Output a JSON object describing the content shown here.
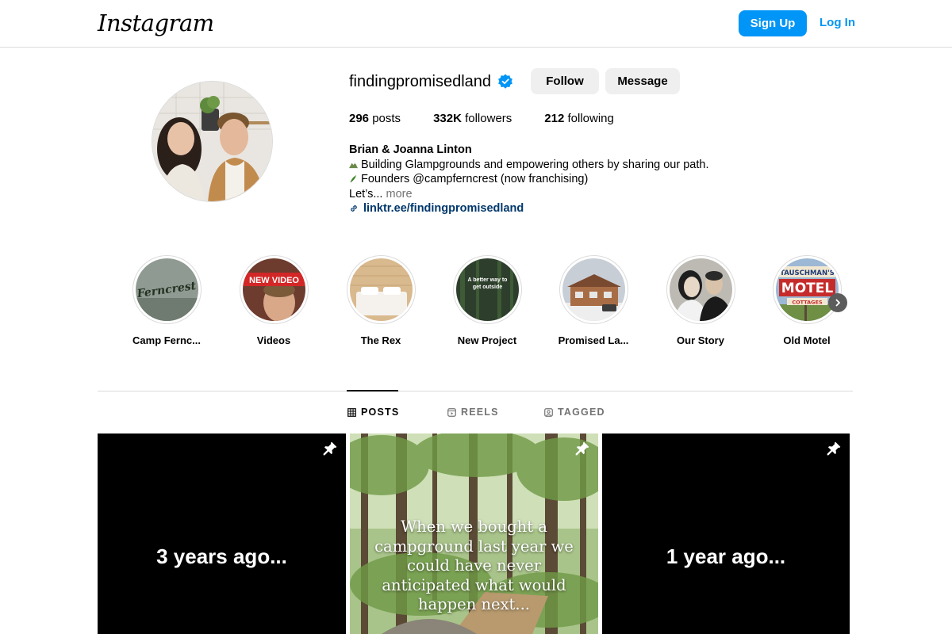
{
  "header": {
    "logo_text": "Instagram",
    "signup_label": "Sign Up",
    "login_label": "Log In"
  },
  "profile": {
    "username": "findingpromisedland",
    "verified": true,
    "follow_label": "Follow",
    "message_label": "Message",
    "stats": [
      {
        "count": "296",
        "label": "posts"
      },
      {
        "count": "332K",
        "label": "followers"
      },
      {
        "count": "212",
        "label": "following"
      }
    ],
    "bio": {
      "name": "Brian & Joanna Linton",
      "line1": "Building Glampgrounds and empowering others by sharing our path.",
      "line2": "Founders @campferncrest (now franchising)",
      "line3": "Let’s...",
      "more_label": "more",
      "link": "linktr.ee/findingpromisedland"
    }
  },
  "highlights": [
    {
      "label": "Camp Fernc..."
    },
    {
      "label": "Videos",
      "badge": "NEW VIDEO"
    },
    {
      "label": "The Rex"
    },
    {
      "label": "New Project",
      "overlay": "A better way to get outside"
    },
    {
      "label": "Promised La..."
    },
    {
      "label": "Our Story"
    },
    {
      "label": "Old Motel",
      "sign_top": "TAUSCHMAN'S",
      "sign_main": "MOTEL",
      "sign_sub": "COTTAGES"
    }
  ],
  "highlight_logo_text": "Ferncrest",
  "tabs": [
    {
      "label": "POSTS",
      "active": true
    },
    {
      "label": "REELS",
      "active": false
    },
    {
      "label": "TAGGED",
      "active": false
    }
  ],
  "posts": [
    {
      "caption": "3 years ago...",
      "pinned": true
    },
    {
      "caption": "When we bought a campground last year we could have never anticipated what would happen next...",
      "pinned": true
    },
    {
      "caption": "1 year ago...",
      "pinned": true
    }
  ],
  "colors": {
    "accent": "#0095f6",
    "link": "#00376b",
    "secondary_text": "#737373",
    "button_bg": "#efefef",
    "verified": "#0095f6"
  }
}
